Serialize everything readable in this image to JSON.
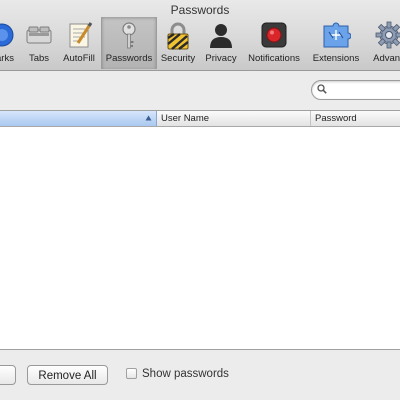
{
  "window": {
    "title": "Passwords"
  },
  "toolbar": {
    "items": [
      {
        "label": "arks",
        "icon": "bookmarks-icon"
      },
      {
        "label": "Tabs",
        "icon": "tabs-icon"
      },
      {
        "label": "AutoFill",
        "icon": "autofill-icon"
      },
      {
        "label": "Passwords",
        "icon": "key-icon",
        "selected": true
      },
      {
        "label": "Security",
        "icon": "lock-icon"
      },
      {
        "label": "Privacy",
        "icon": "person-silhouette-icon"
      },
      {
        "label": "Notifications",
        "icon": "notifications-icon"
      },
      {
        "label": "Extensions",
        "icon": "puzzle-icon"
      },
      {
        "label": "Advanc",
        "icon": "gear-icon"
      }
    ]
  },
  "search": {
    "value": "",
    "placeholder": ""
  },
  "table": {
    "columns": [
      {
        "label": "",
        "sorted": true
      },
      {
        "label": "User Name"
      },
      {
        "label": "Password"
      }
    ],
    "rows": []
  },
  "bottom_bar": {
    "remove_label": "",
    "remove_all_label": "Remove All",
    "show_passwords_label": "Show passwords",
    "show_passwords_checked": false
  },
  "colors": {
    "selection_header": "#aac8f0",
    "notifications_red": "#d8262b"
  }
}
